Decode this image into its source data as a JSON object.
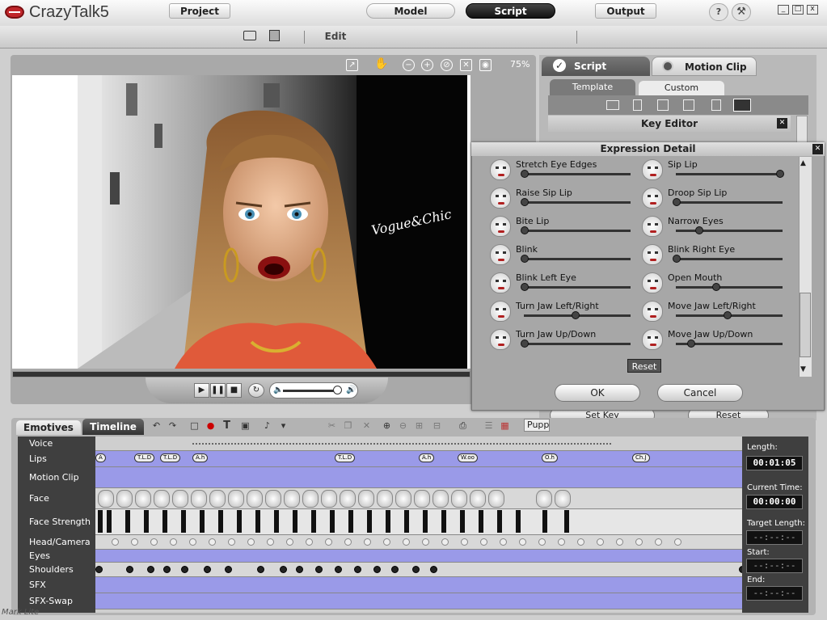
{
  "app": {
    "title": "CrazyTalk5",
    "help_icon": "?",
    "close_glyph": "x"
  },
  "modebar": {
    "project": "Project",
    "edit": "Edit",
    "model": "Model",
    "script": "Script",
    "output": "Output"
  },
  "viewport": {
    "zoom": "75%",
    "scene_text": "Vogue&Chic"
  },
  "right_panel": {
    "tab_script": "Script",
    "tab_motion_clip": "Motion Clip",
    "subtab_template": "Template",
    "subtab_custom": "Custom",
    "key_editor": "Key Editor",
    "set_key": "Set Key",
    "reset": "Reset"
  },
  "expression_dialog": {
    "title": "Expression Detail",
    "items": [
      {
        "label": "Stretch Eye Edges",
        "value": 0.0
      },
      {
        "label": "Sip Lip",
        "value": 1.0
      },
      {
        "label": "Raise Sip Lip",
        "value": 0.0
      },
      {
        "label": "Droop Sip Lip",
        "value": 0.0
      },
      {
        "label": "Bite Lip",
        "value": 0.0
      },
      {
        "label": "Narrow Eyes",
        "value": 0.22
      },
      {
        "label": "Blink",
        "value": 0.0
      },
      {
        "label": "Blink Right Eye",
        "value": 0.0
      },
      {
        "label": "Blink Left Eye",
        "value": 0.0
      },
      {
        "label": "Open Mouth",
        "value": 0.38
      },
      {
        "label": "Turn Jaw Left/Right",
        "value": 0.49
      },
      {
        "label": "Move Jaw Left/Right",
        "value": 0.49
      },
      {
        "label": "Turn Jaw Up/Down",
        "value": 0.0
      },
      {
        "label": "Move Jaw Up/Down",
        "value": 0.14
      }
    ],
    "reset": "Reset",
    "ok": "OK",
    "cancel": "Cancel"
  },
  "timeline": {
    "tab_emotives": "Emotives",
    "tab_timeline": "Timeline",
    "puppet_label": "Pupp",
    "tracks": [
      "Voice",
      "Lips",
      "Motion Clip",
      "Face",
      "Face Strength",
      "Head/Camera",
      "Eyes",
      "Shoulders",
      "SFX",
      "SFX-Swap"
    ],
    "lip_tags": [
      {
        "text": "A",
        "pos": 0.0
      },
      {
        "text": "T.L.D",
        "pos": 0.06
      },
      {
        "text": "T.L.D",
        "pos": 0.1
      },
      {
        "text": "A.h",
        "pos": 0.15
      },
      {
        "text": "T.L.D",
        "pos": 0.37
      },
      {
        "text": "A.h",
        "pos": 0.5
      },
      {
        "text": "W.oo",
        "pos": 0.56
      },
      {
        "text": "O.h",
        "pos": 0.69
      },
      {
        "text": "Ch.J",
        "pos": 0.83
      }
    ],
    "info": {
      "length_label": "Length:",
      "length_value": "00:01:05",
      "current_label": "Current Time:",
      "current_value": "00:00:00",
      "target_label": "Target Length:",
      "target_value": "--:--:--",
      "start_label": "Start:",
      "start_value": "--:--:--",
      "end_label": "End:",
      "end_value": "--:--:--"
    }
  },
  "watermark": "Mark Lite"
}
